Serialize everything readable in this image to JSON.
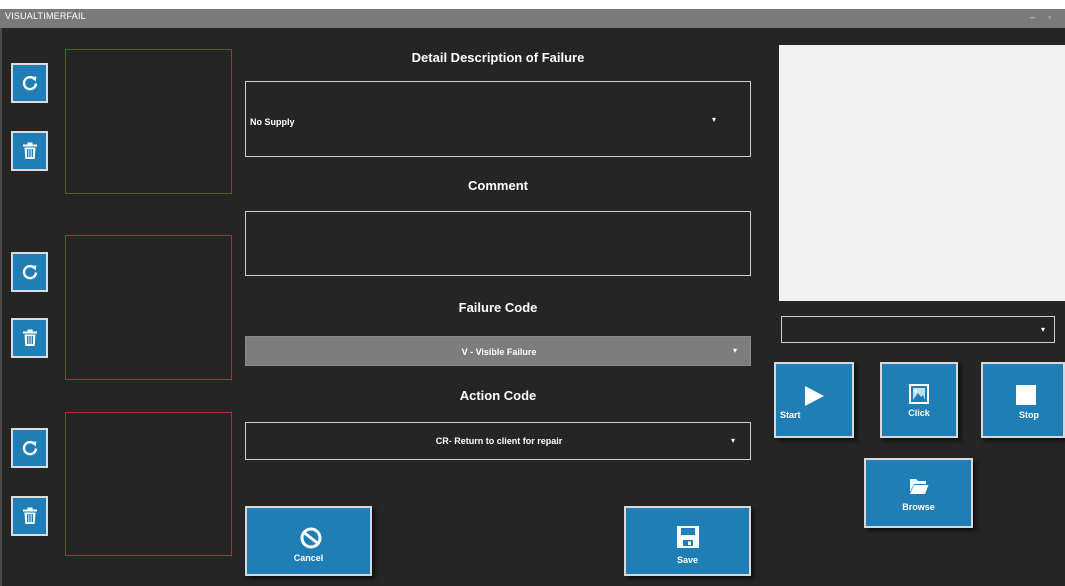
{
  "window": {
    "title": "VISUALTIMERFAIL",
    "minimize_glyph": "–",
    "maximize_glyph": "▫"
  },
  "photo_slots": [
    {
      "refresh_icon": "refresh-icon",
      "delete_icon": "trash-icon"
    },
    {
      "refresh_icon": "refresh-icon",
      "delete_icon": "trash-icon"
    },
    {
      "refresh_icon": "refresh-icon",
      "delete_icon": "trash-icon"
    }
  ],
  "form": {
    "detail_heading": "Detail Description of Failure",
    "detail_value": "No Supply",
    "comment_heading": "Comment",
    "comment_value": "",
    "failure_code_heading": "Failure Code",
    "failure_code_value": "V - Visible Failure",
    "action_code_heading": "Action Code",
    "action_code_value": "CR-  Return to client for repair",
    "dropdown_caret": "▾"
  },
  "buttons": {
    "cancel": "Cancel",
    "save": "Save",
    "start": "Start",
    "click": "Click",
    "stop": "Stop",
    "browse": "Browse"
  },
  "camera": {
    "device_value": ""
  },
  "colors": {
    "background": "#252525",
    "accent": "#1e7eb5",
    "photo_border": "#c0262c",
    "failure_code_fill": "#7d7d7d",
    "preview": "#f2f2f2"
  }
}
